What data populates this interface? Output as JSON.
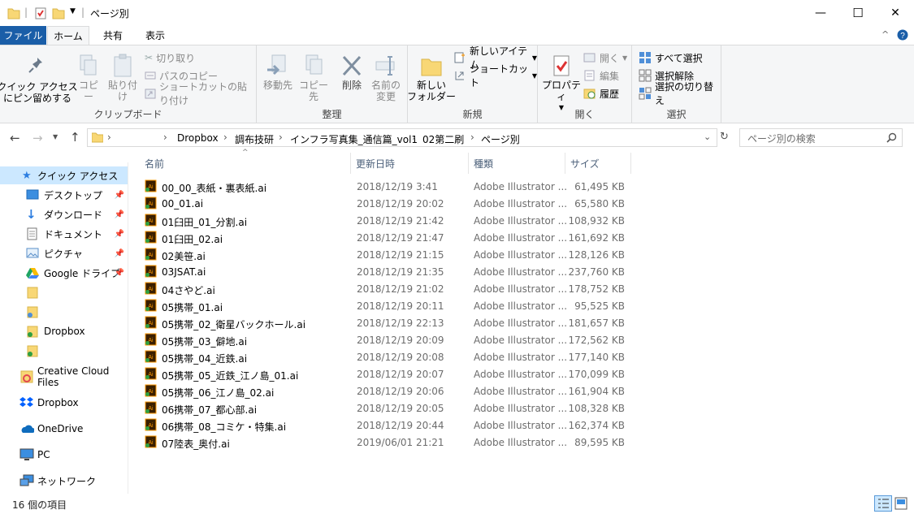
{
  "window": {
    "title": "ページ別",
    "minimize": "—",
    "maximize": "☐",
    "close": "✕"
  },
  "ribbon_tabs": [
    "ファイル",
    "ホーム",
    "共有",
    "表示"
  ],
  "ribbon": {
    "clipboard": {
      "label": "クリップボード",
      "pin_quick": "クイック アクセス\nにピン留めする",
      "copy": "コピー",
      "paste": "貼り付け",
      "cut": "切り取り",
      "copy_path": "パスのコピー",
      "paste_shortcut": "ショートカットの貼り付け"
    },
    "organize": {
      "label": "整理",
      "move_to": "移動先",
      "copy_to": "コピー先",
      "delete": "削除",
      "rename": "名前の\n変更"
    },
    "new": {
      "label": "新規",
      "new_folder": "新しい\nフォルダー",
      "new_item": "新しいアイテム",
      "easy_access": "ショートカット"
    },
    "open": {
      "label": "開く",
      "properties": "プロパティ",
      "open": "開く",
      "edit": "編集",
      "history": "履歴"
    },
    "select": {
      "label": "選択",
      "select_all": "すべて選択",
      "select_none": "選択解除",
      "invert": "選択の切り替え"
    }
  },
  "address": {
    "path": [
      "Dropbox",
      "調布技研",
      "インフラ写真集_通信篇_vol1",
      "02第二刷",
      "ページ別"
    ],
    "search_placeholder": "ページ別の検索"
  },
  "nav": [
    {
      "label": "クイック アクセス",
      "icon": "star-icon",
      "selected": true,
      "pinned": false
    },
    {
      "label": "デスクトップ",
      "icon": "desktop-icon",
      "pinned": true
    },
    {
      "label": "ダウンロード",
      "icon": "download-icon",
      "pinned": true
    },
    {
      "label": "ドキュメント",
      "icon": "document-icon",
      "pinned": true
    },
    {
      "label": "ピクチャ",
      "icon": "pictures-icon",
      "pinned": true
    },
    {
      "label": "Google ドライブ",
      "icon": "google-drive-icon",
      "pinned": true
    },
    {
      "label": "",
      "icon": "folder-icon"
    },
    {
      "label": "",
      "icon": "folder-icon"
    },
    {
      "label": "Dropbox",
      "icon": "folder-icon"
    },
    {
      "label": "",
      "icon": "folder-icon"
    },
    {
      "label": "Creative Cloud Files",
      "icon": "creative-cloud-icon"
    },
    {
      "label": "Dropbox",
      "icon": "dropbox-icon"
    },
    {
      "label": "OneDrive",
      "icon": "onedrive-icon"
    },
    {
      "label": "PC",
      "icon": "pc-icon"
    },
    {
      "label": "ネットワーク",
      "icon": "network-icon"
    }
  ],
  "columns": [
    "名前",
    "更新日時",
    "種類",
    "サイズ"
  ],
  "files": [
    {
      "name": "00_00_表紙・裏表紙.ai",
      "date": "2018/12/19 3:41",
      "type": "Adobe Illustrator ...",
      "size": "61,495 KB"
    },
    {
      "name": "00_01.ai",
      "date": "2018/12/19 20:02",
      "type": "Adobe Illustrator ...",
      "size": "65,580 KB"
    },
    {
      "name": "01臼田_01_分割.ai",
      "date": "2018/12/19 21:42",
      "type": "Adobe Illustrator ...",
      "size": "108,932 KB"
    },
    {
      "name": "01臼田_02.ai",
      "date": "2018/12/19 21:47",
      "type": "Adobe Illustrator ...",
      "size": "161,692 KB"
    },
    {
      "name": "02美笹.ai",
      "date": "2018/12/19 21:15",
      "type": "Adobe Illustrator ...",
      "size": "128,126 KB"
    },
    {
      "name": "03JSAT.ai",
      "date": "2018/12/19 21:35",
      "type": "Adobe Illustrator ...",
      "size": "237,760 KB"
    },
    {
      "name": "04さやど.ai",
      "date": "2018/12/19 21:02",
      "type": "Adobe Illustrator ...",
      "size": "178,752 KB"
    },
    {
      "name": "05携帯_01.ai",
      "date": "2018/12/19 20:11",
      "type": "Adobe Illustrator ...",
      "size": "95,525 KB"
    },
    {
      "name": "05携帯_02_衛星バックホール.ai",
      "date": "2018/12/19 22:13",
      "type": "Adobe Illustrator ...",
      "size": "181,657 KB"
    },
    {
      "name": "05携帯_03_僻地.ai",
      "date": "2018/12/19 20:09",
      "type": "Adobe Illustrator ...",
      "size": "172,562 KB"
    },
    {
      "name": "05携帯_04_近鉄.ai",
      "date": "2018/12/19 20:08",
      "type": "Adobe Illustrator ...",
      "size": "177,140 KB"
    },
    {
      "name": "05携帯_05_近鉄_江ノ島_01.ai",
      "date": "2018/12/19 20:07",
      "type": "Adobe Illustrator ...",
      "size": "170,099 KB"
    },
    {
      "name": "05携帯_06_江ノ島_02.ai",
      "date": "2018/12/19 20:06",
      "type": "Adobe Illustrator ...",
      "size": "161,904 KB"
    },
    {
      "name": "06携帯_07_都心部.ai",
      "date": "2018/12/19 20:05",
      "type": "Adobe Illustrator ...",
      "size": "108,328 KB"
    },
    {
      "name": "06携帯_08_コミケ・特集.ai",
      "date": "2018/12/19 20:44",
      "type": "Adobe Illustrator ...",
      "size": "162,374 KB"
    },
    {
      "name": "07陸表_奥付.ai",
      "date": "2019/06/01 21:21",
      "type": "Adobe Illustrator ...",
      "size": "89,595 KB"
    }
  ],
  "status": {
    "count": "16 個の項目"
  },
  "colors": {
    "accent": "#1a5ea8",
    "selected": "#cce8ff",
    "header_text": "#4c607a",
    "muted_text": "#6d6d6d",
    "folder": "#f8d775",
    "ai_icon": "#ff9a00"
  }
}
